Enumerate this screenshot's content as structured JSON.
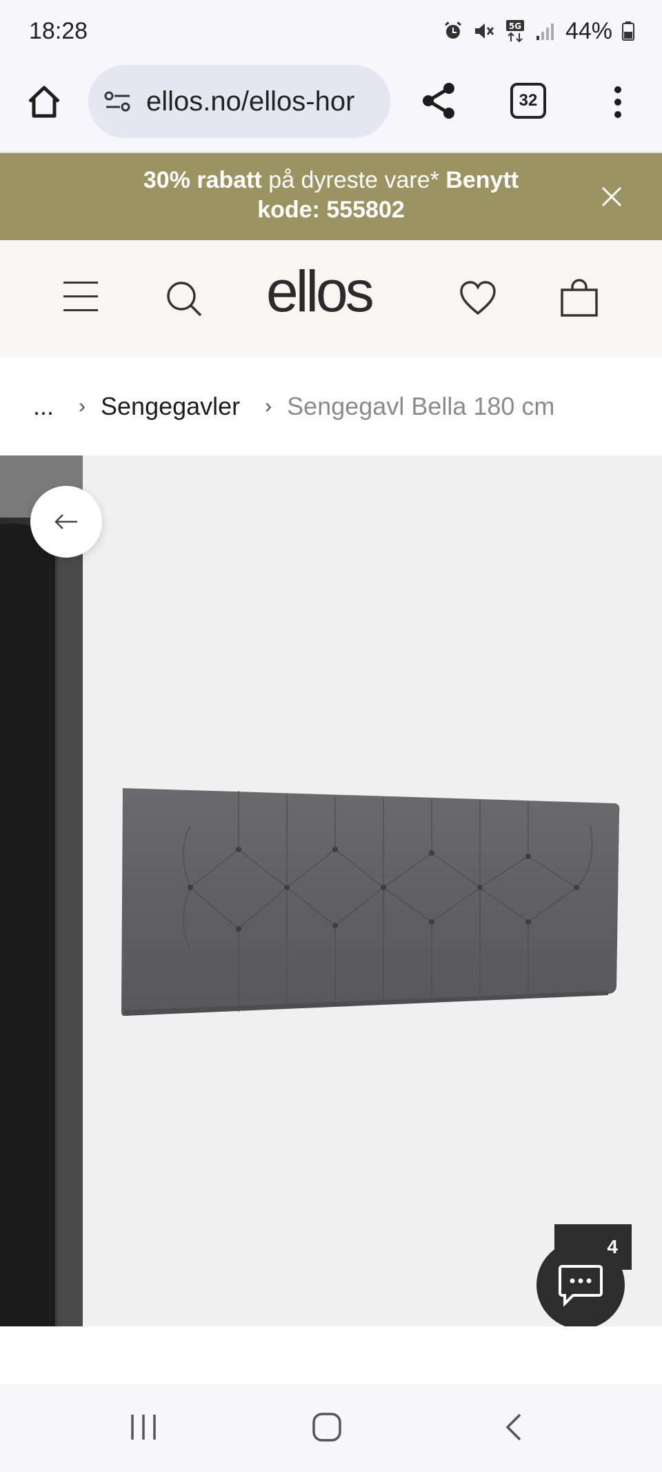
{
  "status_bar": {
    "time": "18:28",
    "battery": "44%",
    "icons": [
      "alarm-icon",
      "mute-icon",
      "5g-icon",
      "signal-icon",
      "battery-icon"
    ]
  },
  "browser": {
    "url": "ellos.no/ellos-hor",
    "tab_count": "32",
    "icons": [
      "home-icon",
      "site-settings-icon",
      "share-icon",
      "tabs-icon",
      "more-icon"
    ]
  },
  "promo": {
    "bold_1": "30% rabatt",
    "text_1": " på dyreste vare* ",
    "bold_2": "Benytt kode: 555802",
    "background": "#9b9462"
  },
  "header": {
    "logo": "ellos",
    "background": "#f8f6f2"
  },
  "breadcrumb": {
    "ellipsis": "...",
    "category": "Sengegavler",
    "current": "Sengegavl Bella 180 cm"
  },
  "gallery": {
    "counter": "4"
  }
}
